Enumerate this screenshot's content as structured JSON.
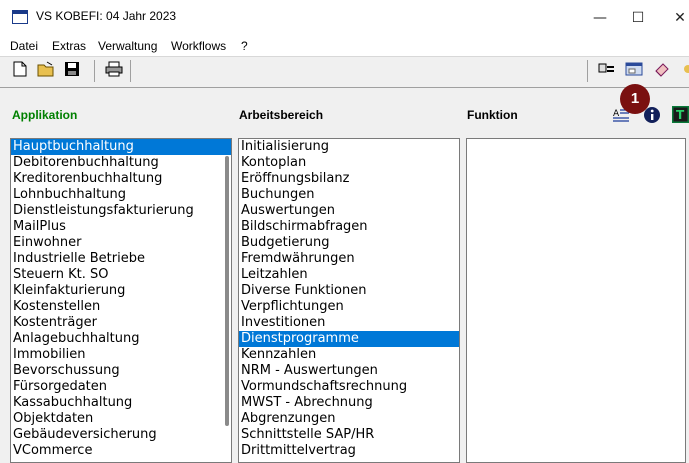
{
  "window": {
    "title": "VS KOBEFI: 04 Jahr 2023",
    "minimize": "—",
    "maximize": "☐",
    "close": "✕"
  },
  "menu": [
    "Datei",
    "Extras",
    "Verwaltung",
    "Workflows",
    "?"
  ],
  "toolbar": {
    "left": [
      "new-file-icon",
      "open-folder-icon",
      "save-disk-icon",
      "printer-icon"
    ],
    "right": [
      "tools-icon",
      "window-icon",
      "eraser-icon"
    ]
  },
  "headers": {
    "applikation": "Applikation",
    "arbeitsbereich": "Arbeitsbereich",
    "funktion": "Funktion"
  },
  "header_icons": {
    "sort": "sort-icon",
    "info": "info-icon",
    "text": "T"
  },
  "badge": "1",
  "colors": {
    "applikation_header": "#008000",
    "selection": "#0078d7",
    "badge": "#7a1010"
  },
  "applikation": {
    "selected": "Hauptbuchhaltung",
    "items": [
      "Hauptbuchhaltung",
      "Debitorenbuchhaltung",
      "Kreditorenbuchhaltung",
      "Lohnbuchhaltung",
      "Dienstleistungsfakturierung",
      "MailPlus",
      "Einwohner",
      "Industrielle Betriebe",
      "Steuern Kt. SO",
      "Kleinfakturierung",
      "Kostenstellen",
      "Kostenträger",
      "Anlagebuchhaltung",
      "Immobilien",
      "Bevorschussung",
      "Fürsorgedaten",
      "Kassabuchhaltung",
      "Objektdaten",
      "Gebäudeversicherung",
      "VCommerce"
    ]
  },
  "arbeitsbereich": {
    "selected": "Dienstprogramme",
    "items": [
      "Initialisierung",
      "Kontoplan",
      "Eröffnungsbilanz",
      "Buchungen",
      "Auswertungen",
      "Bildschirmabfragen",
      "Budgetierung",
      "Fremdwährungen",
      "Leitzahlen",
      "Diverse Funktionen",
      "Verpflichtungen",
      "Investitionen",
      "Dienstprogramme",
      "Kennzahlen",
      "NRM - Auswertungen",
      "Vormundschaftsrechnung",
      "MWST - Abrechnung",
      "Abgrenzungen",
      "Schnittstelle SAP/HR",
      "Drittmittelvertrag"
    ]
  },
  "funktion": {
    "items": []
  }
}
